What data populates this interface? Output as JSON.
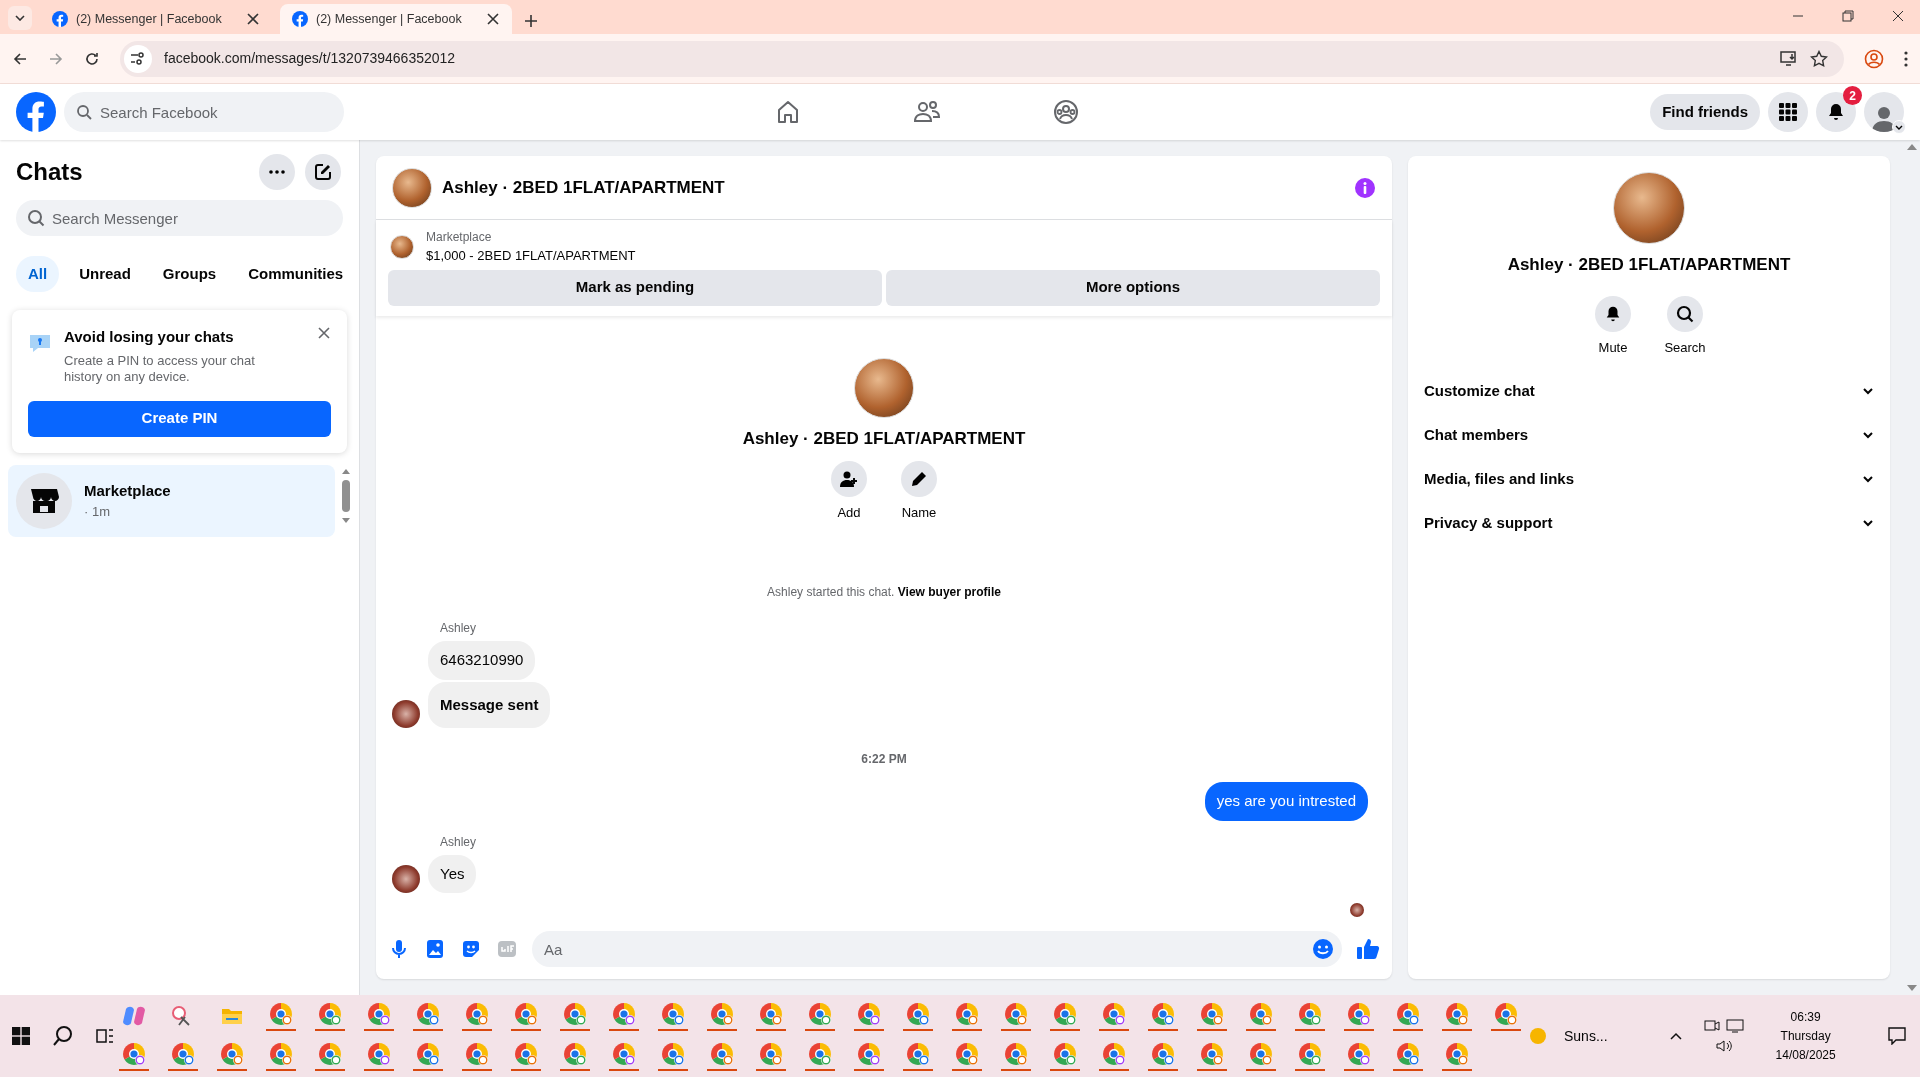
{
  "browser": {
    "tabs": [
      {
        "title": "(2) Messenger | Facebook",
        "selected": false
      },
      {
        "title": "(2) Messenger | Facebook",
        "selected": true
      }
    ],
    "url": "facebook.com/messages/t/1320739466352012"
  },
  "header": {
    "search_placeholder": "Search Facebook",
    "find_friends": "Find friends",
    "notification_count": "2"
  },
  "sidebar": {
    "title": "Chats",
    "search_placeholder": "Search Messenger",
    "filters": [
      {
        "label": "All",
        "selected": true
      },
      {
        "label": "Unread",
        "selected": false
      },
      {
        "label": "Groups",
        "selected": false
      },
      {
        "label": "Communities",
        "selected": false
      }
    ],
    "pin_card": {
      "title": "Avoid losing your chats",
      "text": "Create a PIN to access your chat history on any device.",
      "button": "Create PIN"
    },
    "chats": [
      {
        "name": "Marketplace",
        "meta": "· 1m",
        "selected": true
      }
    ]
  },
  "conversation": {
    "title": "Ashley · 2BED 1FLAT/APARTMENT",
    "listing": {
      "label": "Marketplace",
      "title": "$1,000 - 2BED 1FLAT/APARTMENT"
    },
    "actions": [
      "Mark as pending",
      "More options"
    ],
    "profile": {
      "name": "Ashley · 2BED 1FLAT/APARTMENT",
      "actions": [
        {
          "kind": "add",
          "label": "Add"
        },
        {
          "kind": "name",
          "label": "Name"
        }
      ]
    },
    "messages": [
      {
        "kind": "system",
        "text": "Ashley started this chat.",
        "link": "View buyer profile"
      },
      {
        "kind": "incoming",
        "sender": "Ashley",
        "bubbles": [
          {
            "text": "6463210990",
            "bold": false
          },
          {
            "text": "Message sent",
            "bold": true
          }
        ]
      },
      {
        "kind": "timestamp",
        "text": "6:22 PM"
      },
      {
        "kind": "outgoing",
        "text": "yes are you intrested"
      },
      {
        "kind": "incoming",
        "sender": "Ashley",
        "bubbles": [
          {
            "text": "Yes",
            "bold": false
          }
        ]
      },
      {
        "kind": "seen"
      }
    ],
    "composer": {
      "placeholder": "Aa"
    }
  },
  "details": {
    "name": "Ashley · 2BED 1FLAT/APARTMENT",
    "actions": [
      {
        "kind": "mute",
        "label": "Mute"
      },
      {
        "kind": "search",
        "label": "Search"
      }
    ],
    "sections": [
      {
        "title": "Customize chat",
        "expanded": false
      },
      {
        "title": "Chat members",
        "expanded": false
      },
      {
        "title": "Media, files and links",
        "expanded": false
      },
      {
        "title": "Privacy & support",
        "expanded": false
      }
    ]
  },
  "taskbar": {
    "weather": "Suns...",
    "time": "06:39",
    "day": "Thursday",
    "date": "14/08/2025"
  }
}
